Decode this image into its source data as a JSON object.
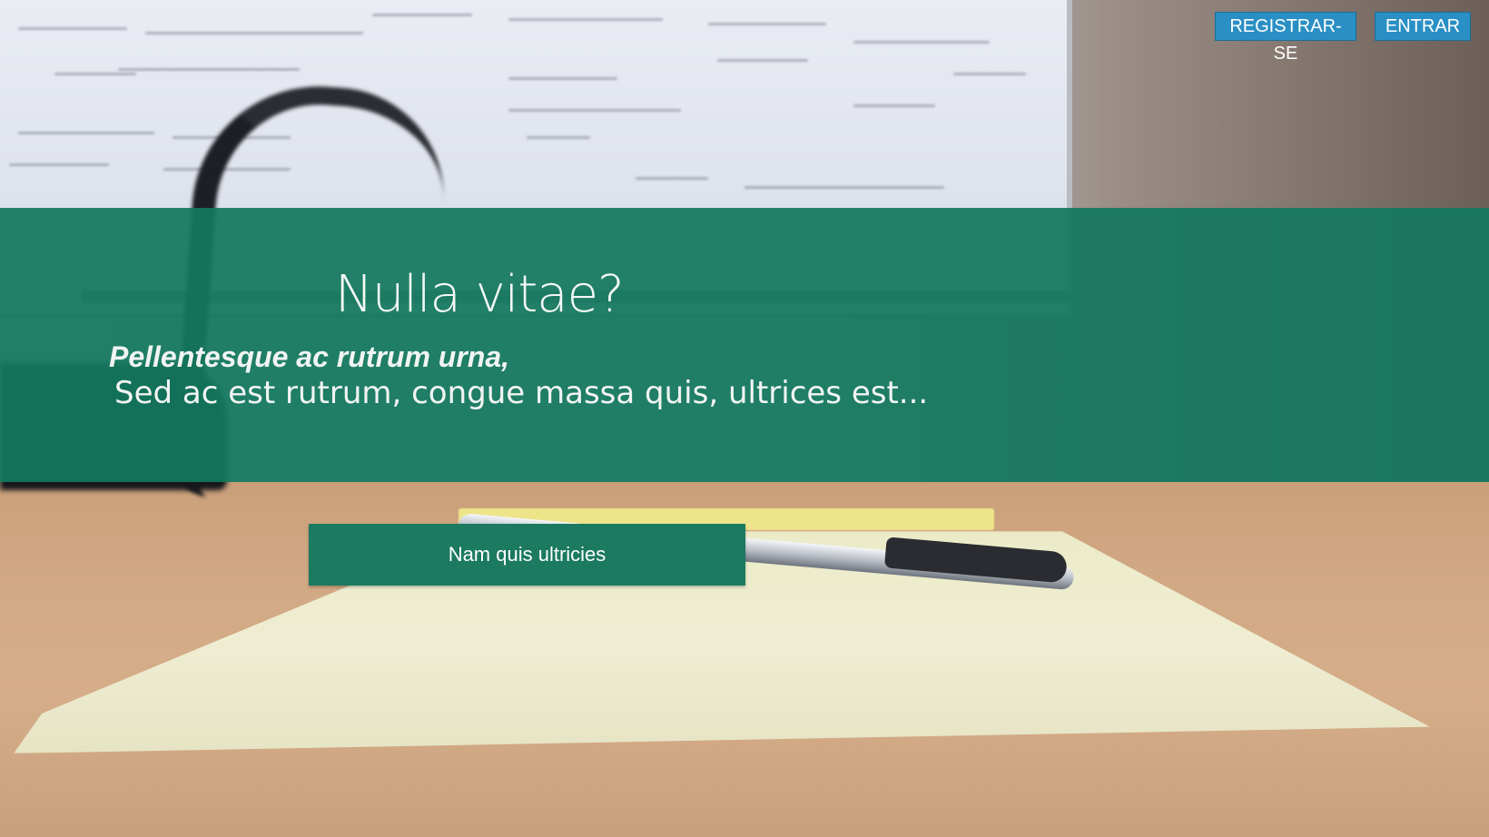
{
  "nav": {
    "register_label": "REGISTRAR-SE",
    "login_label": "ENTRAR"
  },
  "hero": {
    "title": "Nulla vitae?",
    "subtitle_bold": "Pellentesque ac rutrum urna,",
    "subtitle": "Sed ac est rutrum, congue massa quis, ultrices est..."
  },
  "cta": {
    "label": "Nam quis ultricies"
  },
  "colors": {
    "banner_green": "#13785e",
    "cta_green": "#1b7a5f",
    "nav_blue": "#2a8fc4"
  }
}
